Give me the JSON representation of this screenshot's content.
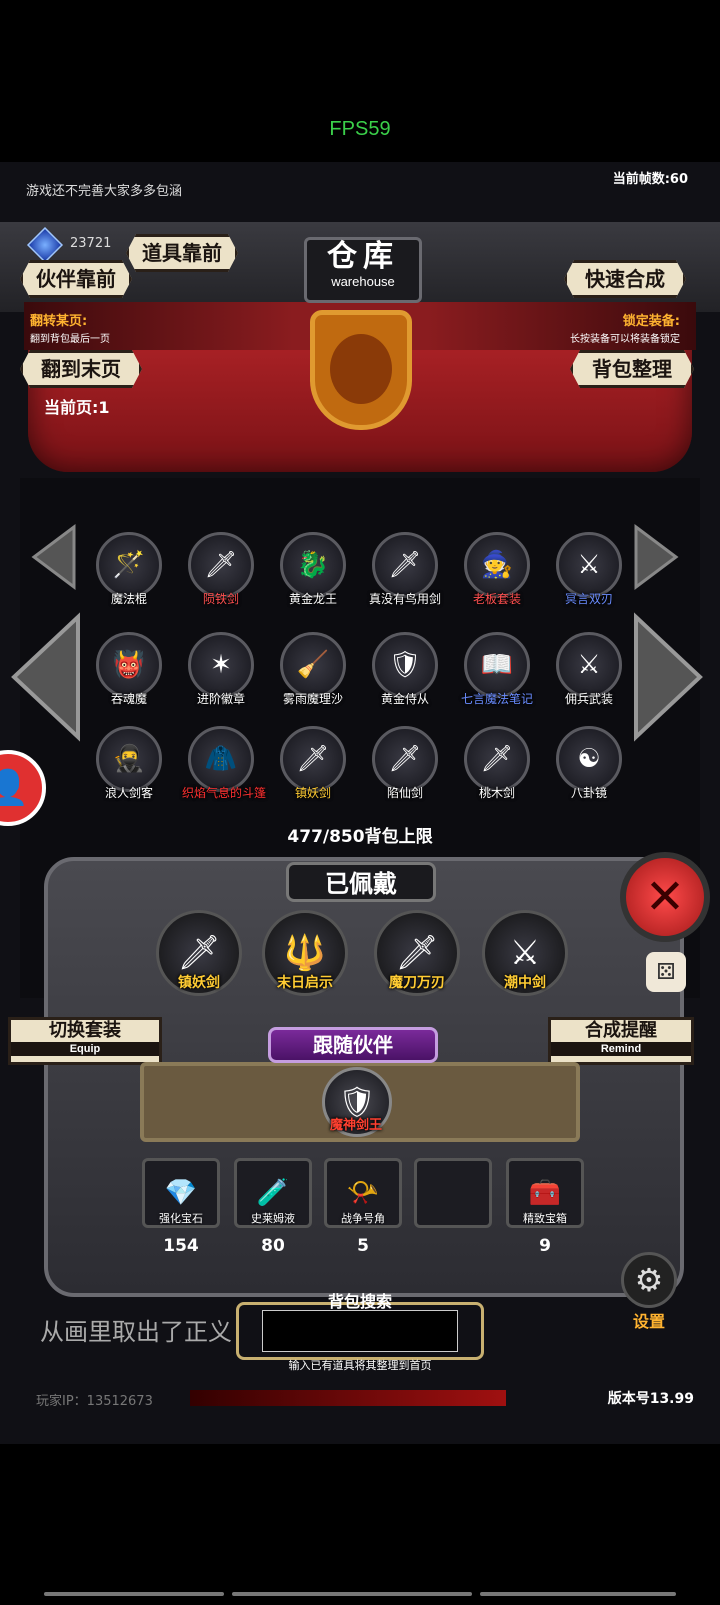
{
  "status": {
    "fps_label": "FPS59"
  },
  "header": {
    "notice": "游戏还不完善大家多多包涵",
    "frame_rate": "当前帧数:60",
    "currency": "23721",
    "title_cn": "仓库",
    "title_en": "warehouse",
    "btn_companion_front": "伙伴靠前",
    "btn_item_front": "道具靠前",
    "btn_quick_merge": "快速合成",
    "flip_label": "翻转某页:",
    "flip_hint": "翻到背包最后一页",
    "lock_label": "锁定装备:",
    "lock_hint": "长按装备可以将装备锁定",
    "btn_last_page": "翻到末页",
    "btn_sort": "背包整理",
    "current_page": "当前页:1"
  },
  "inventory": {
    "rows": [
      [
        {
          "name": "魔法棍",
          "icon": "staff-icon",
          "glyph": "🪄",
          "color": "#ffffff"
        },
        {
          "name": "陨铁剑",
          "icon": "sword-icon",
          "glyph": "🗡",
          "color": "#ff5050"
        },
        {
          "name": "黄金龙王",
          "icon": "dragon-icon",
          "glyph": "🐉",
          "color": "#ffffff"
        },
        {
          "name": "真没有鸟用剑",
          "icon": "sword-icon",
          "glyph": "🗡",
          "color": "#ffffff"
        },
        {
          "name": "老板套装",
          "icon": "armor-icon",
          "glyph": "🧙",
          "color": "#ff5050"
        },
        {
          "name": "冥言双刃",
          "icon": "blades-icon",
          "glyph": "⚔",
          "color": "#6a8cff"
        }
      ],
      [
        {
          "name": "吞魂魔",
          "icon": "demon-icon",
          "glyph": "👹",
          "color": "#ffffff"
        },
        {
          "name": "进阶徽章",
          "icon": "badge-icon",
          "glyph": "✶",
          "color": "#ffffff"
        },
        {
          "name": "雾雨魔理沙",
          "icon": "witch-icon",
          "glyph": "🧹",
          "color": "#ffffff"
        },
        {
          "name": "黄金侍从",
          "icon": "samurai-icon",
          "glyph": "🛡",
          "color": "#ffffff"
        },
        {
          "name": "七言魔法笔记",
          "icon": "book-icon",
          "glyph": "📖",
          "color": "#6a8cff"
        },
        {
          "name": "佣兵武装",
          "icon": "knight-icon",
          "glyph": "⚔",
          "color": "#ffffff"
        }
      ],
      [
        {
          "name": "浪人剑客",
          "icon": "ronin-icon",
          "glyph": "🥷",
          "color": "#ffffff"
        },
        {
          "name": "织焰气息的斗篷",
          "icon": "cloak-icon",
          "glyph": "🧥",
          "color": "#ff3030"
        },
        {
          "name": "镇妖剑",
          "icon": "sword-icon",
          "glyph": "🗡",
          "color": "#ffcc33"
        },
        {
          "name": "陷仙剑",
          "icon": "sword-icon",
          "glyph": "🗡",
          "color": "#ffffff"
        },
        {
          "name": "桃木剑",
          "icon": "wooden-sword-icon",
          "glyph": "🗡",
          "color": "#ffffff"
        },
        {
          "name": "八卦镜",
          "icon": "bagua-mirror-icon",
          "glyph": "☯",
          "color": "#ffffff"
        }
      ]
    ],
    "capacity": "477/850背包上限"
  },
  "equipped": {
    "title": "已佩戴",
    "items": [
      {
        "name": "镇妖剑",
        "icon": "sword-icon",
        "glyph": "🗡"
      },
      {
        "name": "末日启示",
        "icon": "trident-icon",
        "glyph": "🔱"
      },
      {
        "name": "魔刀万刃",
        "icon": "blade-icon",
        "glyph": "🗡"
      },
      {
        "name": "潮中剑",
        "icon": "greatsword-icon",
        "glyph": "⚔"
      }
    ],
    "switch_cn": "切换套装",
    "switch_en": "Equip",
    "remind_cn": "合成提醒",
    "remind_en": "Remind",
    "follow_title": "跟随伙伴",
    "companion_name": "魔神剑王"
  },
  "materials": [
    {
      "name": "强化宝石",
      "count": "154",
      "icon": "gem-icon",
      "glyph": "💎"
    },
    {
      "name": "史莱姆液",
      "count": "80",
      "icon": "potion-icon",
      "glyph": "🧪"
    },
    {
      "name": "战争号角",
      "count": "5",
      "icon": "horn-icon",
      "glyph": "📯"
    },
    {
      "name": "",
      "count": "",
      "icon": "empty-slot",
      "glyph": ""
    },
    {
      "name": "精致宝箱",
      "count": "9",
      "icon": "chest-icon",
      "glyph": "🧰"
    }
  ],
  "footer": {
    "message": "从画里取出了正义",
    "search_label": "背包搜索",
    "search_value": "",
    "search_hint": "输入已有道具将其整理到首页",
    "settings_label": "设置",
    "player_ip": "玩家IP：13512673",
    "version": "版本号13.99"
  }
}
